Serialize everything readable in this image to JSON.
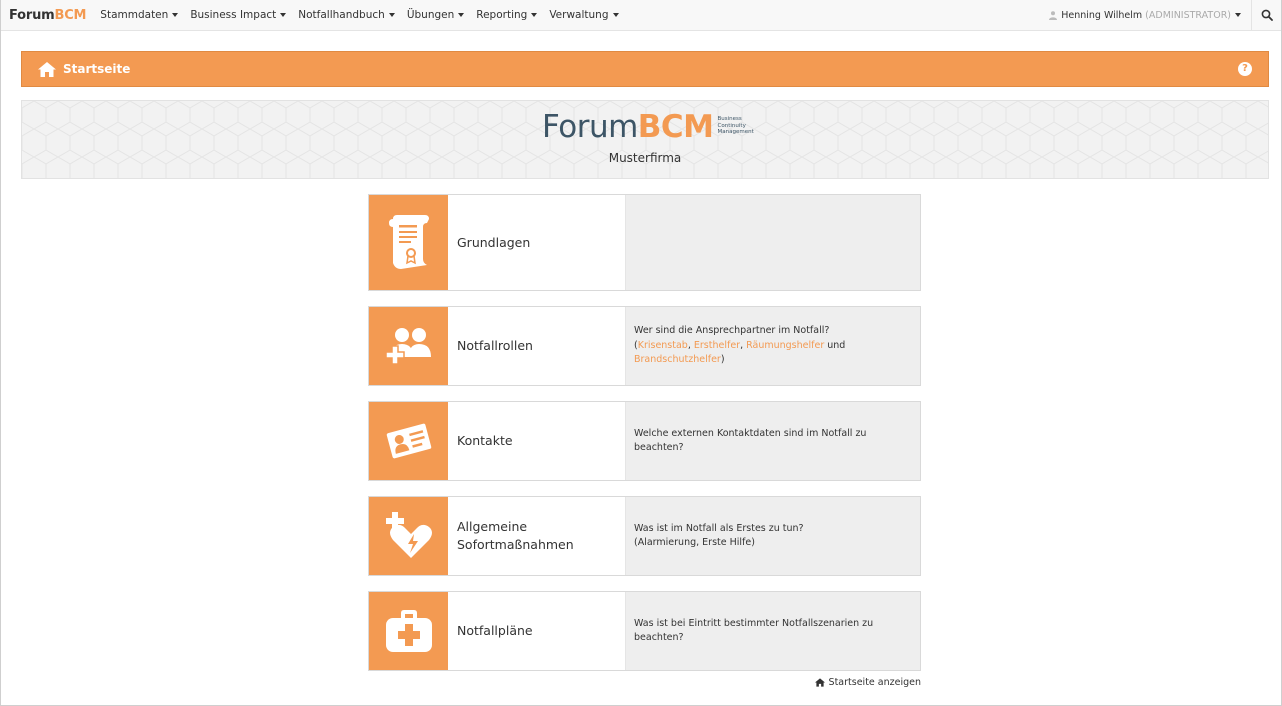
{
  "navbar": {
    "brand_part1": "Forum",
    "brand_part2": "BCM",
    "menu": [
      {
        "label": "Stammdaten"
      },
      {
        "label": "Business Impact"
      },
      {
        "label": "Notfallhandbuch"
      },
      {
        "label": "Übungen"
      },
      {
        "label": "Reporting"
      },
      {
        "label": "Verwaltung"
      }
    ],
    "user_name": "Henning Wilhelm",
    "user_role": "(ADMINISTRATOR)"
  },
  "pagebar": {
    "title": "Startseite",
    "help": "?"
  },
  "banner": {
    "logo_part1": "Forum",
    "logo_part2": "BCM",
    "tagline": [
      "Business",
      "Continuity",
      "Management"
    ],
    "company": "Musterfirma"
  },
  "tiles": [
    {
      "label": "Grundlagen",
      "icon": "certificate-scroll-icon",
      "desc": ""
    },
    {
      "label": "Notfallrollen",
      "icon": "people-cross-icon",
      "desc_line1": "Wer sind die Ansprechpartner im Notfall?",
      "desc_open": "(",
      "link1": "Krisenstab",
      "sep1": ", ",
      "link2": "Ersthelfer",
      "sep2": ", ",
      "link3": "Räumungshelfer",
      "sep3": " und",
      "link4": "Brandschutzhelfer",
      "desc_close": ")"
    },
    {
      "label": "Kontakte",
      "icon": "contact-card-icon",
      "desc": "Welche externen Kontaktdaten sind im Notfall zu beachten?"
    },
    {
      "label_line1": "Allgemeine",
      "label_line2": "Sofortmaßnahmen",
      "icon": "heart-defibrillator-icon",
      "desc_line1": "Was ist im Notfall als Erstes zu tun?",
      "desc_line2": "(Alarmierung, Erste Hilfe)"
    },
    {
      "label": "Notfallpläne",
      "icon": "first-aid-kit-icon",
      "desc_line1": "Was ist bei Eintritt bestimmter Notfallszenarien zu",
      "desc_line2": "beachten?"
    }
  ],
  "footer": {
    "link": "Startseite anzeigen"
  },
  "colors": {
    "accent": "#f39a52",
    "tile_desc_bg": "#eeeeee",
    "logo_dark": "#3d5566"
  }
}
